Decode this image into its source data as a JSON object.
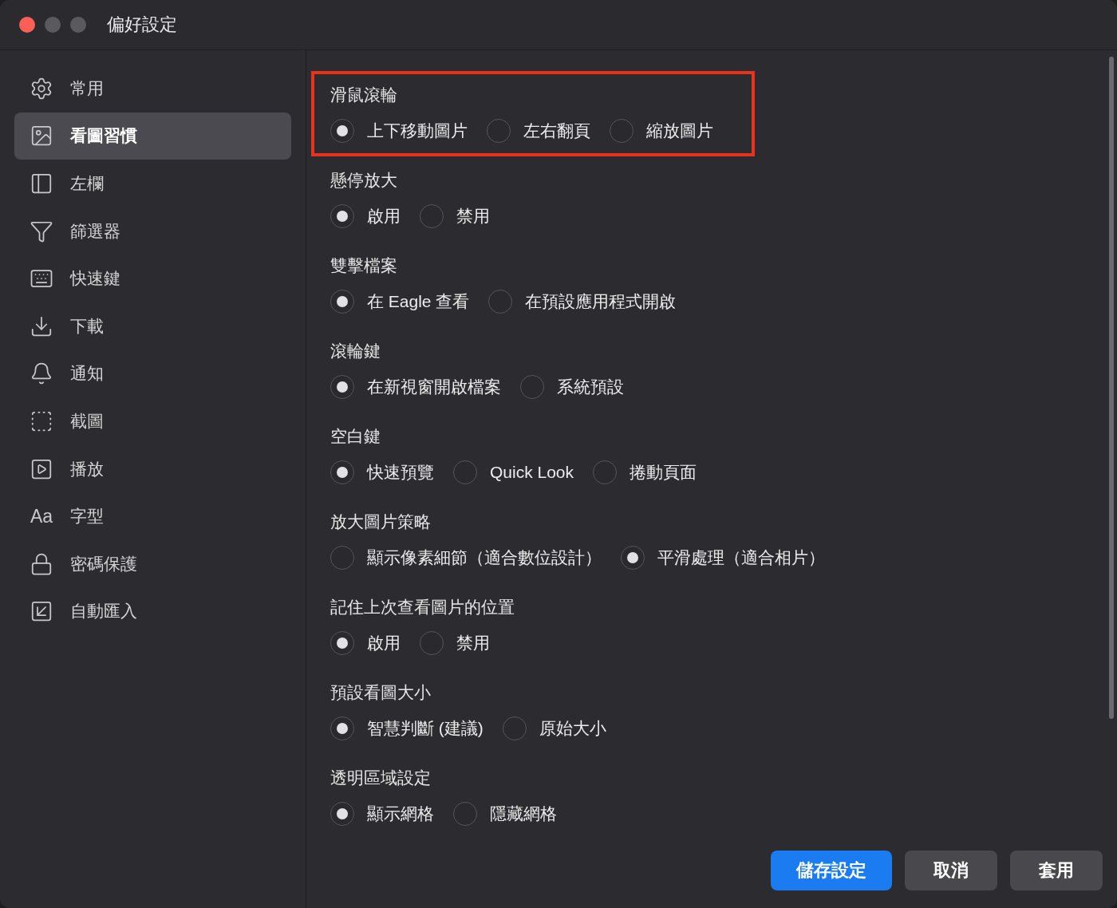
{
  "window": {
    "title": "偏好設定"
  },
  "sidebar": {
    "items": [
      {
        "label": "常用",
        "selected": false
      },
      {
        "label": "看圖習慣",
        "selected": true
      },
      {
        "label": "左欄",
        "selected": false
      },
      {
        "label": "篩選器",
        "selected": false
      },
      {
        "label": "快速鍵",
        "selected": false
      },
      {
        "label": "下載",
        "selected": false
      },
      {
        "label": "通知",
        "selected": false
      },
      {
        "label": "截圖",
        "selected": false
      },
      {
        "label": "播放",
        "selected": false
      },
      {
        "label": "字型",
        "selected": false,
        "glyph": "Aa"
      },
      {
        "label": "密碼保護",
        "selected": false
      },
      {
        "label": "自動匯入",
        "selected": false
      }
    ]
  },
  "groups": [
    {
      "title": "滑鼠滾輪",
      "highlighted": true,
      "options": [
        {
          "label": "上下移動圖片",
          "selected": true
        },
        {
          "label": "左右翻頁",
          "selected": false
        },
        {
          "label": "縮放圖片",
          "selected": false
        }
      ]
    },
    {
      "title": "懸停放大",
      "highlighted": false,
      "options": [
        {
          "label": "啟用",
          "selected": true
        },
        {
          "label": "禁用",
          "selected": false
        }
      ]
    },
    {
      "title": "雙擊檔案",
      "highlighted": false,
      "options": [
        {
          "label": "在 Eagle 查看",
          "selected": true
        },
        {
          "label": "在預設應用程式開啟",
          "selected": false
        }
      ]
    },
    {
      "title": "滾輪鍵",
      "highlighted": false,
      "options": [
        {
          "label": "在新視窗開啟檔案",
          "selected": true
        },
        {
          "label": "系統預設",
          "selected": false
        }
      ]
    },
    {
      "title": "空白鍵",
      "highlighted": false,
      "options": [
        {
          "label": "快速預覽",
          "selected": true
        },
        {
          "label": "Quick Look",
          "selected": false
        },
        {
          "label": "捲動頁面",
          "selected": false
        }
      ]
    },
    {
      "title": "放大圖片策略",
      "highlighted": false,
      "options": [
        {
          "label": "顯示像素細節（適合數位設計）",
          "selected": false
        },
        {
          "label": "平滑處理（適合相片）",
          "selected": true
        }
      ]
    },
    {
      "title": "記住上次查看圖片的位置",
      "highlighted": false,
      "options": [
        {
          "label": "啟用",
          "selected": true
        },
        {
          "label": "禁用",
          "selected": false
        }
      ]
    },
    {
      "title": "預設看圖大小",
      "highlighted": false,
      "options": [
        {
          "label": "智慧判斷 (建議)",
          "selected": true
        },
        {
          "label": "原始大小",
          "selected": false
        }
      ]
    },
    {
      "title": "透明區域設定",
      "highlighted": false,
      "options": [
        {
          "label": "顯示網格",
          "selected": true
        },
        {
          "label": "隱藏網格",
          "selected": false
        }
      ]
    }
  ],
  "buttons": [
    {
      "label": "儲存設定",
      "kind": "primary"
    },
    {
      "label": "取消",
      "kind": "secondary"
    },
    {
      "label": "套用",
      "kind": "secondary"
    }
  ]
}
